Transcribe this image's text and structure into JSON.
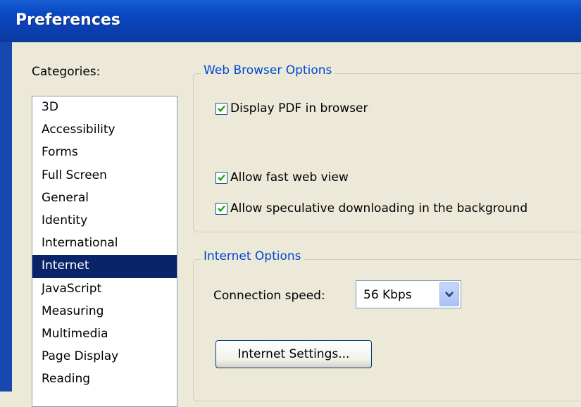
{
  "window": {
    "title": "Preferences"
  },
  "categories": {
    "label": "Categories:",
    "items": [
      "3D",
      "Accessibility",
      "Forms",
      "Full Screen",
      "General",
      "Identity",
      "International",
      "Internet",
      "JavaScript",
      "Measuring",
      "Multimedia",
      "Page Display",
      "Reading"
    ],
    "selected": "Internet"
  },
  "web_browser_options": {
    "legend": "Web Browser Options",
    "display_pdf": {
      "label": "Display PDF in browser",
      "checked": true
    },
    "fast_web_view": {
      "label": "Allow fast web view",
      "checked": true
    },
    "speculative_download": {
      "label": "Allow speculative downloading in the background",
      "checked": true
    }
  },
  "internet_options": {
    "legend": "Internet Options",
    "connection_speed_label": "Connection speed:",
    "connection_speed_value": "56 Kbps",
    "settings_button": "Internet Settings..."
  },
  "colors": {
    "titlebar": "#0a3fb0",
    "selection": "#0a246a",
    "legend_text": "#0046d5",
    "dialog_bg": "#ece9d8"
  }
}
